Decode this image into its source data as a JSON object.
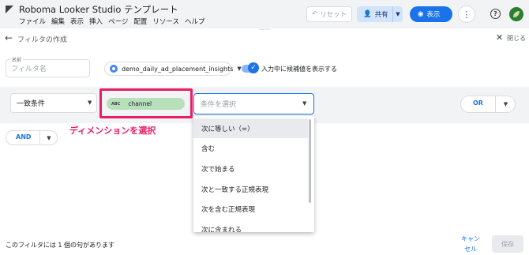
{
  "app": {
    "title": "Roboma Looker Studio テンプレート",
    "menu": [
      "ファイル",
      "編集",
      "表示",
      "挿入",
      "ページ",
      "配置",
      "リソース",
      "ヘルプ"
    ]
  },
  "toolbar": {
    "reset_label": "リセット",
    "share_label": "共有",
    "view_label": "表示"
  },
  "panel": {
    "title": "フィルタの作成",
    "close_label": "閉じる"
  },
  "name": {
    "label": "名前",
    "placeholder": "フィルタ名"
  },
  "data_source": "demo_daily_ad_placement_insights",
  "toggle_label": "入力中に候補値を表示する",
  "condition": {
    "match_type": "一致条件",
    "dimension_type": "ABC",
    "dimension": "channel",
    "operator_placeholder": "条件を選択",
    "or_label": "OR",
    "and_label": "AND"
  },
  "annotation": "ディメンションを選択",
  "dropdown_options": [
    "次に等しい（=）",
    "含む",
    "次で始まる",
    "次と一致する正規表現",
    "次を含む正規表現",
    "次に含まれる"
  ],
  "footer": {
    "clause_count": "このフィルタには 1 個の句があります",
    "cancel_label": "キャンセル",
    "save_label": "保存"
  },
  "colors": {
    "accent": "#1a73e8",
    "highlight": "#e91e63",
    "dimension_chip": "#b7dfb9"
  }
}
